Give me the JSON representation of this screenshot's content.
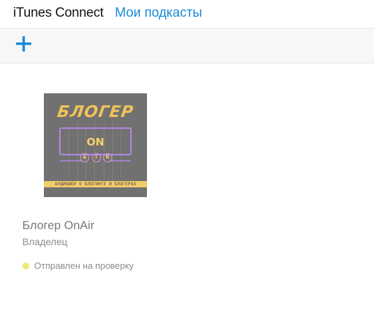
{
  "header": {
    "brand": "iTunes Connect",
    "section_link": "Мои подкасты"
  },
  "toolbar": {
    "add_icon": "plus-icon",
    "accent_color": "#1a8ad8"
  },
  "podcasts": [
    {
      "title": "Блогер OnAir",
      "role": "Владелец",
      "status": "Отправлен на проверку",
      "status_color": "#eeea7a",
      "artwork": {
        "title": "БЛОГЕР",
        "on": "ON",
        "air_letters": [
          "A",
          "I",
          "R"
        ],
        "band": "АУДИОШОУ О БЛОГИНГЕ И БЛОГЕРАХ"
      }
    }
  ]
}
